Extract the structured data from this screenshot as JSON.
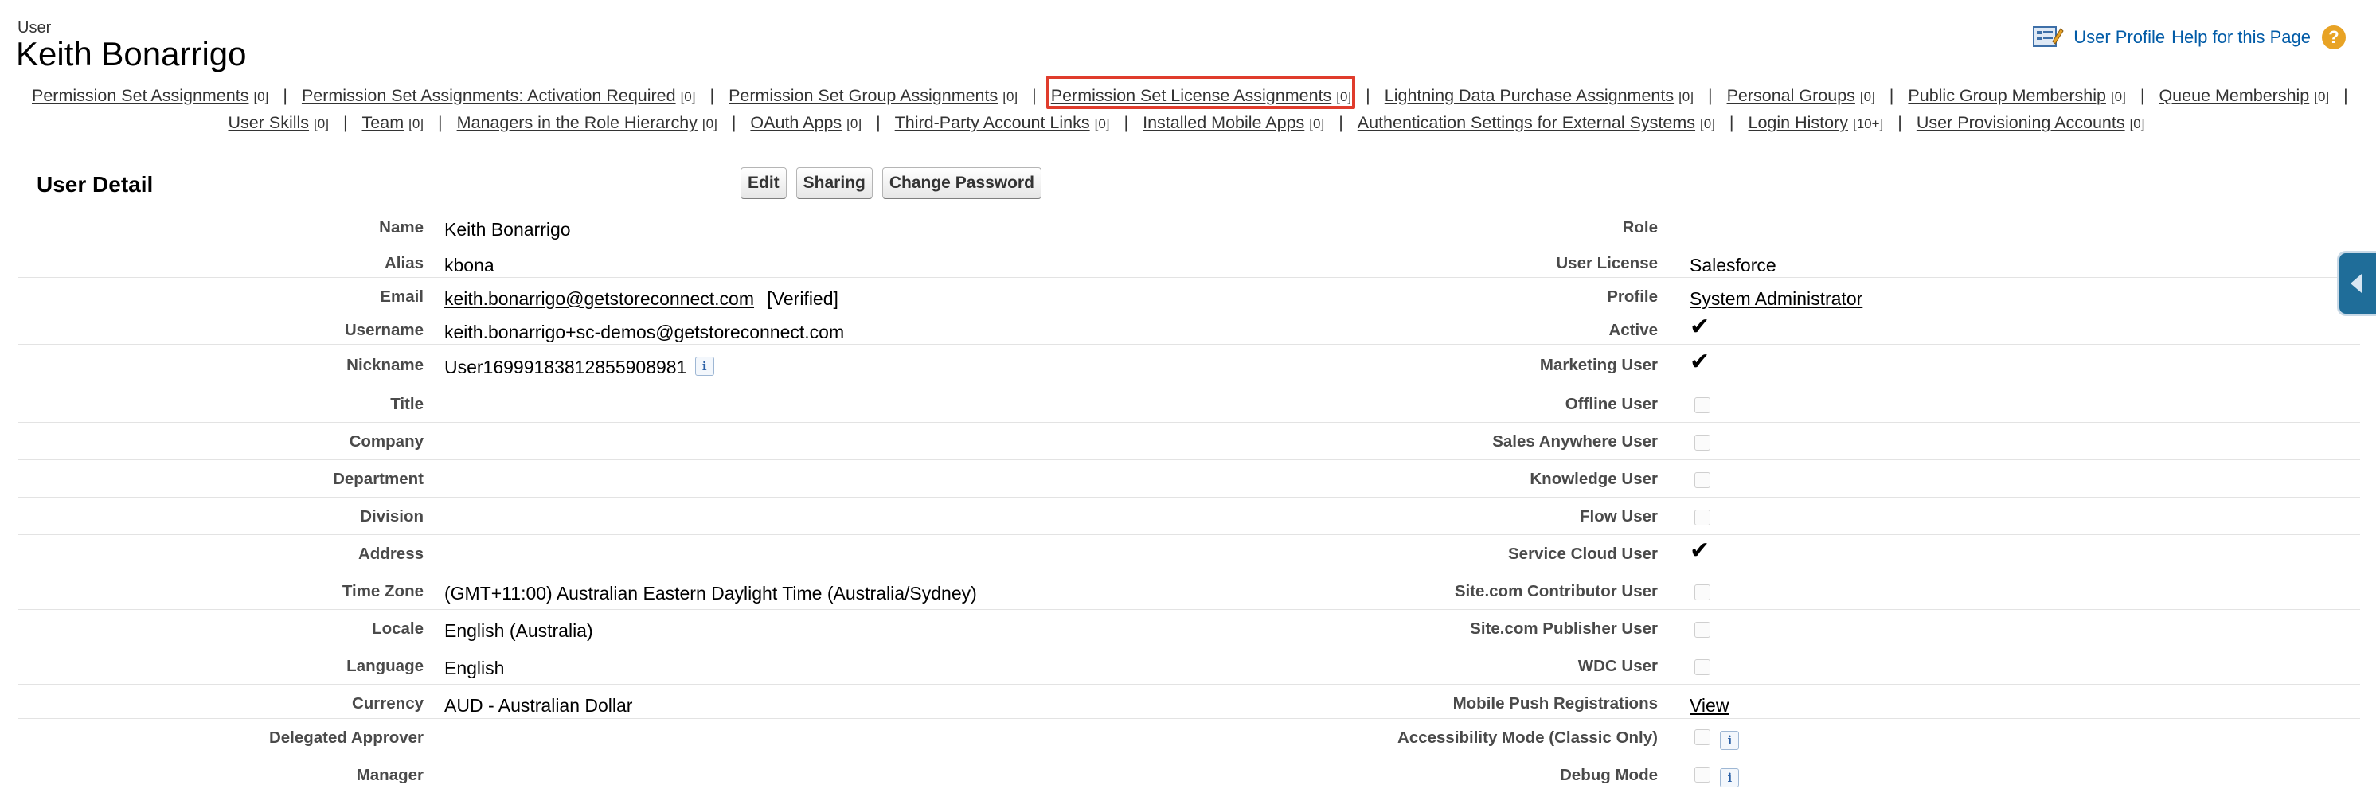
{
  "header": {
    "label": "User",
    "name": "Keith Bonarrigo",
    "profile_link": "User Profile",
    "help_link": "Help for this Page",
    "help_icon_glyph": "?"
  },
  "related_links": [
    {
      "label": "Permission Set Assignments",
      "count": "[0]"
    },
    {
      "label": "Permission Set Assignments: Activation Required",
      "count": "[0]"
    },
    {
      "label": "Permission Set Group Assignments",
      "count": "[0]"
    },
    {
      "label": "Permission Set License Assignments",
      "count": "[0]"
    },
    {
      "label": "Lightning Data Purchase Assignments",
      "count": "[0]"
    },
    {
      "label": "Personal Groups",
      "count": "[0]"
    },
    {
      "label": "Public Group Membership",
      "count": "[0]"
    },
    {
      "label": "Queue Membership",
      "count": "[0]"
    },
    {
      "label": "User Skills",
      "count": "[0]"
    },
    {
      "label": "Team",
      "count": "[0]"
    },
    {
      "label": "Managers in the Role Hierarchy",
      "count": "[0]"
    },
    {
      "label": "OAuth Apps",
      "count": "[0]"
    },
    {
      "label": "Third-Party Account Links",
      "count": "[0]"
    },
    {
      "label": "Installed Mobile Apps",
      "count": "[0]"
    },
    {
      "label": "Authentication Settings for External Systems",
      "count": "[0]"
    },
    {
      "label": "Login History",
      "count": "[10+]"
    },
    {
      "label": "User Provisioning Accounts",
      "count": "[0]"
    }
  ],
  "section": {
    "title": "User Detail",
    "buttons": {
      "edit": "Edit",
      "sharing": "Sharing",
      "change_password": "Change Password"
    }
  },
  "fields": {
    "name": {
      "label": "Name",
      "value": "Keith Bonarrigo"
    },
    "alias": {
      "label": "Alias",
      "value": "kbona"
    },
    "email": {
      "label": "Email",
      "value": "keith.bonarrigo@getstoreconnect.com",
      "suffix": "[Verified]"
    },
    "username": {
      "label": "Username",
      "value": "keith.bonarrigo+sc-demos@getstoreconnect.com"
    },
    "nickname": {
      "label": "Nickname",
      "value": "User16999183812855908981"
    },
    "title": {
      "label": "Title",
      "value": ""
    },
    "company": {
      "label": "Company",
      "value": ""
    },
    "department": {
      "label": "Department",
      "value": ""
    },
    "division": {
      "label": "Division",
      "value": ""
    },
    "address": {
      "label": "Address",
      "value": ""
    },
    "time_zone": {
      "label": "Time Zone",
      "value": "(GMT+11:00) Australian Eastern Daylight Time (Australia/Sydney)"
    },
    "locale": {
      "label": "Locale",
      "value": "English (Australia)"
    },
    "language": {
      "label": "Language",
      "value": "English"
    },
    "currency": {
      "label": "Currency",
      "value": "AUD - Australian Dollar"
    },
    "delegated_approver": {
      "label": "Delegated Approver",
      "value": ""
    },
    "manager": {
      "label": "Manager",
      "value": ""
    }
  },
  "right_fields": {
    "role": {
      "label": "Role",
      "value": ""
    },
    "user_license": {
      "label": "User License",
      "value": "Salesforce"
    },
    "profile": {
      "label": "Profile",
      "value": "System Administrator"
    },
    "active": {
      "label": "Active",
      "checked": true
    },
    "marketing_user": {
      "label": "Marketing User",
      "checked": true
    },
    "offline_user": {
      "label": "Offline User",
      "checked": false
    },
    "sales_anywhere_user": {
      "label": "Sales Anywhere User",
      "checked": false
    },
    "knowledge_user": {
      "label": "Knowledge User",
      "checked": false
    },
    "flow_user": {
      "label": "Flow User",
      "checked": false
    },
    "service_cloud_user": {
      "label": "Service Cloud User",
      "checked": true
    },
    "site_contributor": {
      "label": "Site.com Contributor User",
      "checked": false
    },
    "site_publisher": {
      "label": "Site.com Publisher User",
      "checked": false
    },
    "wdc_user": {
      "label": "WDC User",
      "checked": false
    },
    "mobile_push": {
      "label": "Mobile Push Registrations",
      "value": "View"
    },
    "accessibility_mode": {
      "label": "Accessibility Mode (Classic Only)",
      "checked": false
    },
    "debug_mode": {
      "label": "Debug Mode",
      "checked": false
    }
  },
  "icons": {
    "check_glyph": "✔",
    "info_glyph": "i"
  },
  "colors": {
    "link_blue": "#015ba7",
    "highlight_border": "#e03c2c",
    "help_orange": "#e8a325",
    "side_tab": "#1f6d99"
  }
}
